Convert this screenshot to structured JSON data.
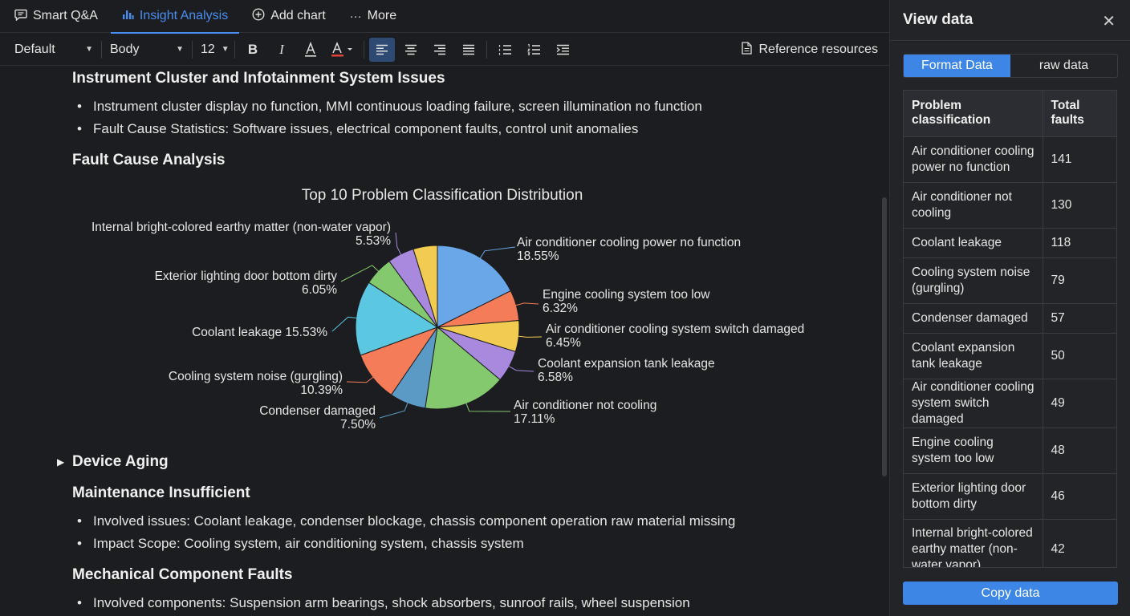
{
  "tabs": [
    {
      "label": "Smart Q&A",
      "icon": "chat-icon",
      "active": false
    },
    {
      "label": "Insight Analysis",
      "icon": "bar-chart-icon",
      "active": true
    },
    {
      "label": "Add chart",
      "icon": "plus-circle-icon",
      "active": false
    },
    {
      "label": "More",
      "icon": "ellipsis-icon",
      "active": false
    }
  ],
  "toolbar": {
    "style_select": "Default",
    "block_select": "Body",
    "size_select": "12",
    "reference_label": "Reference resources"
  },
  "doc": {
    "h_instrument": "Instrument Cluster and Infotainment System Issues",
    "b_instrument_1": "Instrument cluster display no function, MMI continuous loading failure, screen illumination no function",
    "b_instrument_2": "Fault Cause Statistics: Software issues, electrical component faults, control unit anomalies",
    "h_fault": "Fault Cause Analysis",
    "h_aging": "Device Aging",
    "h_maintenance": "Maintenance Insufficient",
    "b_maint_1": "Involved issues: Coolant leakage, condenser blockage, chassis component operation raw material missing",
    "b_maint_2": "Impact Scope: Cooling system, air conditioning system, chassis system",
    "h_mechanical": "Mechanical Component Faults",
    "b_mech_1": "Involved components: Suspension arm bearings, shock absorbers, sunroof rails, wheel suspension"
  },
  "chart_data": {
    "type": "pie",
    "title": "Top 10 Problem Classification Distribution",
    "slices": [
      {
        "label": "Air conditioner cooling power no function",
        "pct": "18.55%",
        "value": 18.55,
        "color": "#6aa7e8"
      },
      {
        "label": "Engine cooling system too low",
        "pct": "6.32%",
        "value": 6.32,
        "color": "#f47c58"
      },
      {
        "label": "Air conditioner cooling system switch damaged",
        "pct": "6.45%",
        "value": 6.45,
        "color": "#f2cc50"
      },
      {
        "label": "Coolant expansion tank leakage",
        "pct": "6.58%",
        "value": 6.58,
        "color": "#a889dd"
      },
      {
        "label": "Air conditioner not cooling",
        "pct": "17.11%",
        "value": 17.11,
        "color": "#85c96f"
      },
      {
        "label": "Condenser damaged",
        "pct": "7.50%",
        "value": 7.5,
        "color": "#5b9ac4"
      },
      {
        "label": "Cooling system noise (gurgling)",
        "pct": "10.39%",
        "value": 10.39,
        "color": "#f47c58"
      },
      {
        "label": "Coolant leakage",
        "pct": "15.53%",
        "value": 15.53,
        "color": "#5cc7e0"
      },
      {
        "label": "Exterior lighting door bottom dirty",
        "pct": "6.05%",
        "value": 6.05,
        "color": "#85c96f"
      },
      {
        "label": "Internal bright-colored earthy matter (non-water vapor)",
        "pct": "5.53%",
        "value": 5.53,
        "color": "#a889dd"
      },
      {
        "label": "",
        "pct": "",
        "value": 5.0,
        "color": "#f2cc50"
      }
    ]
  },
  "panel": {
    "title": "View data",
    "seg_format": "Format Data",
    "seg_raw": "raw data",
    "col1": "Problem classification",
    "col2": "Total faults",
    "rows": [
      {
        "name": "Air conditioner cooling power no function",
        "count": "141"
      },
      {
        "name": "Air conditioner not cooling",
        "count": "130"
      },
      {
        "name": "Coolant leakage",
        "count": "118"
      },
      {
        "name": "Cooling system noise (gurgling)",
        "count": "79"
      },
      {
        "name": "Condenser damaged",
        "count": "57"
      },
      {
        "name": "Coolant expansion tank leakage",
        "count": "50"
      },
      {
        "name": "Air conditioner cooling system switch damaged",
        "count": "49"
      },
      {
        "name": "Engine cooling system too low",
        "count": "48"
      },
      {
        "name": "Exterior lighting door bottom dirty",
        "count": "46"
      },
      {
        "name": "Internal bright-colored earthy matter (non-water vapor)",
        "count": "42"
      }
    ],
    "copy_label": "Copy data"
  }
}
